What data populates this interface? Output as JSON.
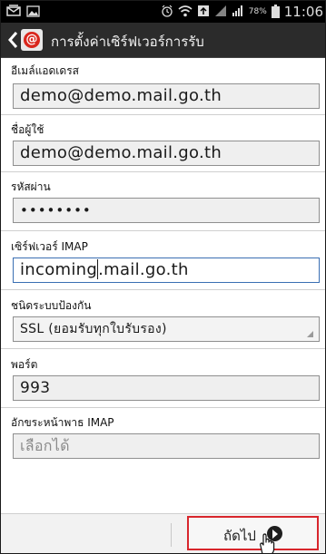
{
  "status_bar": {
    "battery_percent": "78%",
    "time": "11:06",
    "icons": [
      "mail-icon",
      "image-icon",
      "alarm-icon",
      "wifi-icon",
      "sync-icon",
      "data-icon",
      "signal-icon",
      "battery-icon"
    ]
  },
  "action_bar": {
    "title": "การตั้งค่าเซิร์ฟเวอร์การรับ",
    "app_icon": "email-app-icon",
    "back_icon": "chevron-left-icon"
  },
  "form": {
    "email": {
      "label": "อีเมล์แอดเดรส",
      "value": "demo@demo.mail.go.th"
    },
    "username": {
      "label": "ชื่อผู้ใช้",
      "value": "demo@demo.mail.go.th"
    },
    "password": {
      "label": "รหัสผ่าน",
      "value": "••••••••"
    },
    "imap_server": {
      "label": "เซิร์ฟเวอร์ IMAP",
      "value_before_caret": "incoming",
      "value_after_caret": ".mail.go.th"
    },
    "security": {
      "label": "ชนิดระบบป้องกัน",
      "value": "SSL (ยอมรับทุกใบรับรอง)"
    },
    "port": {
      "label": "พอร์ต",
      "value": "993"
    },
    "imap_prefix": {
      "label": "อักขระหน้าพาธ IMAP",
      "placeholder": "เลือกได้"
    }
  },
  "bottom_bar": {
    "next_label": "ถัดไป",
    "highlight_color": "#d8262c"
  }
}
